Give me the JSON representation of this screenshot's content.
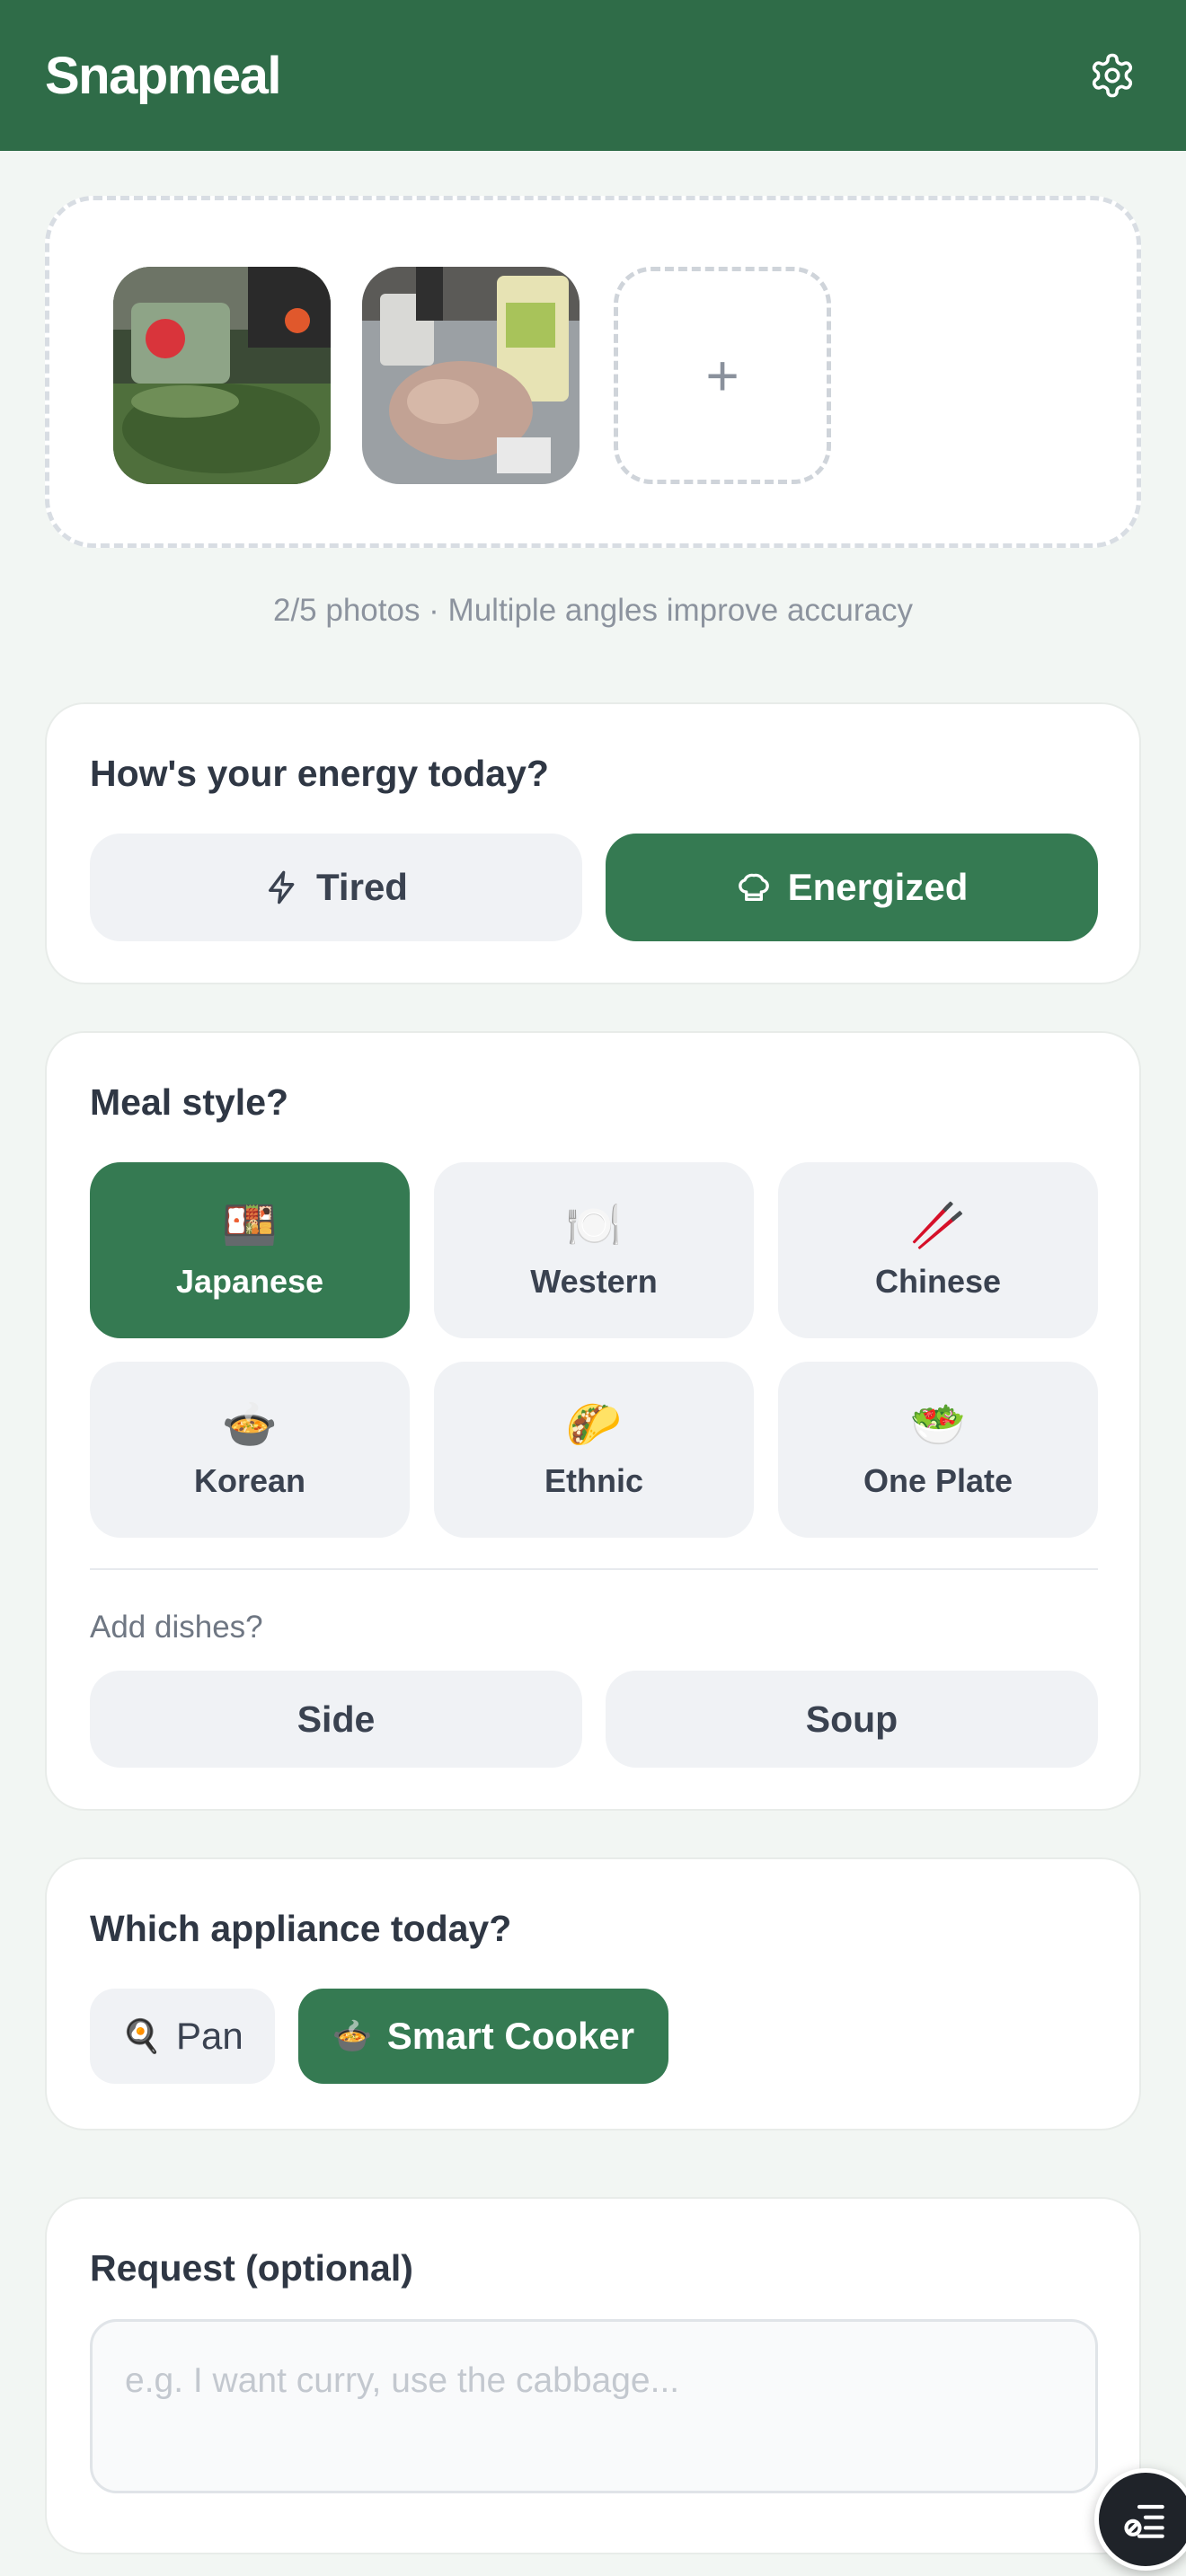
{
  "header": {
    "app_name": "Snapmeal",
    "settings_icon": "gear-icon"
  },
  "photos": {
    "add_symbol": "+",
    "hint": "2/5 photos · Multiple angles improve accuracy"
  },
  "energy": {
    "title": "How's your energy today?",
    "options": [
      {
        "label": "Tired",
        "icon": "lightning-icon",
        "selected": false
      },
      {
        "label": "Energized",
        "icon": "chef-hat-icon",
        "selected": true
      }
    ]
  },
  "meal_style": {
    "title": "Meal style?",
    "options": [
      {
        "label": "Japanese",
        "emoji": "🍱",
        "selected": true
      },
      {
        "label": "Western",
        "emoji": "🍽️",
        "selected": false
      },
      {
        "label": "Chinese",
        "emoji": "🥢",
        "selected": false
      },
      {
        "label": "Korean",
        "emoji": "🍲",
        "selected": false
      },
      {
        "label": "Ethnic",
        "emoji": "🌮",
        "selected": false
      },
      {
        "label": "One Plate",
        "emoji": "🥗",
        "selected": false
      }
    ],
    "add_dishes_label": "Add dishes?",
    "add_dishes": [
      {
        "label": "Side",
        "selected": false
      },
      {
        "label": "Soup",
        "selected": false
      }
    ]
  },
  "appliance": {
    "title": "Which appliance today?",
    "options": [
      {
        "label": "Pan",
        "emoji": "🍳",
        "selected": false
      },
      {
        "label": "Smart Cooker",
        "emoji": "🍲",
        "selected": true
      }
    ]
  },
  "request": {
    "title": "Request (optional)",
    "placeholder": "e.g. I want curry, use the cabbage...",
    "value": ""
  },
  "colors": {
    "brand_green": "#2f6c48",
    "selected_green": "#357a52",
    "unselected_bg": "#f0f2f5",
    "page_bg": "#f2f6f3"
  }
}
